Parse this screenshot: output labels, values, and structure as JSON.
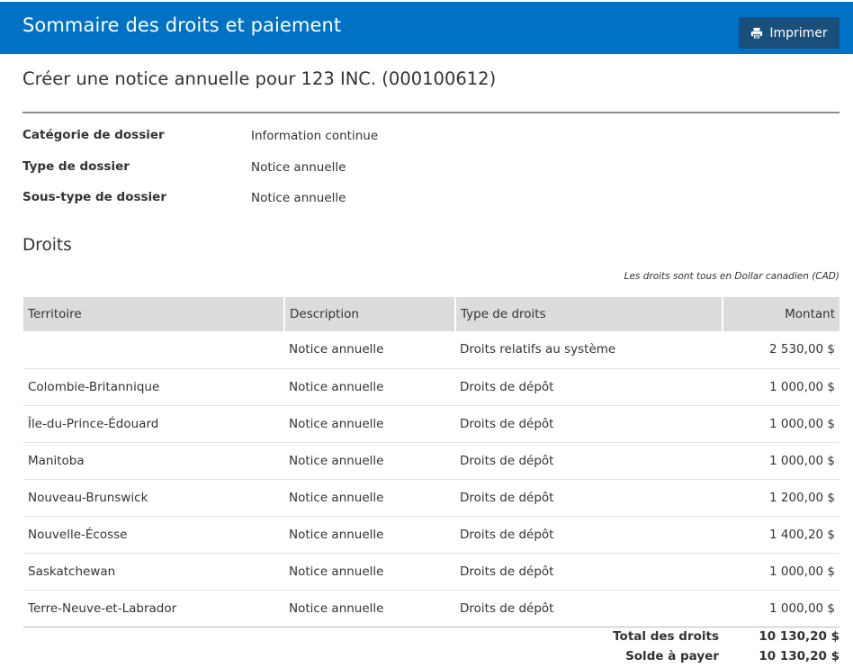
{
  "header": {
    "title": "Sommaire des droits et paiement",
    "print_label": "Imprimer",
    "print_icon": "printer-icon",
    "bg_color": "#0072c6"
  },
  "subtitle": "Créer une notice annuelle pour 123 INC. (000100612)",
  "info": [
    {
      "label": "Catégorie de dossier",
      "value": "Information continue"
    },
    {
      "label": "Type de dossier",
      "value": "Notice annuelle"
    },
    {
      "label": "Sous-type de dossier",
      "value": "Notice annuelle"
    }
  ],
  "fees": {
    "title": "Droits",
    "currency_note": "Les droits sont tous en Dollar canadien (CAD)",
    "columns": [
      "Territoire",
      "Description",
      "Type de droits",
      "Montant"
    ],
    "rows": [
      {
        "territoire": "",
        "description": "Notice annuelle",
        "type": "Droits relatifs au système",
        "montant": "2 530,00 $"
      },
      {
        "territoire": "Colombie-Britannique",
        "description": "Notice annuelle",
        "type": "Droits de dépôt",
        "montant": "1 000,00 $"
      },
      {
        "territoire": "Île-du-Prince-Édouard",
        "description": "Notice annuelle",
        "type": "Droits de dépôt",
        "montant": "1 000,00 $"
      },
      {
        "territoire": "Manitoba",
        "description": "Notice annuelle",
        "type": "Droits de dépôt",
        "montant": "1 000,00 $"
      },
      {
        "territoire": "Nouveau-Brunswick",
        "description": "Notice annuelle",
        "type": "Droits de dépôt",
        "montant": "1 200,00 $"
      },
      {
        "territoire": "Nouvelle-Écosse",
        "description": "Notice annuelle",
        "type": "Droits de dépôt",
        "montant": "1 400,20 $"
      },
      {
        "territoire": "Saskatchewan",
        "description": "Notice annuelle",
        "type": "Droits de dépôt",
        "montant": "1 000,00 $"
      },
      {
        "territoire": "Terre-Neuve-et-Labrador",
        "description": "Notice annuelle",
        "type": "Droits de dépôt",
        "montant": "1 000,00 $"
      }
    ],
    "total_label": "Total des droits",
    "total_value": "10 130,20 $",
    "balance_label": "Solde à payer",
    "balance_value": "10 130,20 $"
  }
}
